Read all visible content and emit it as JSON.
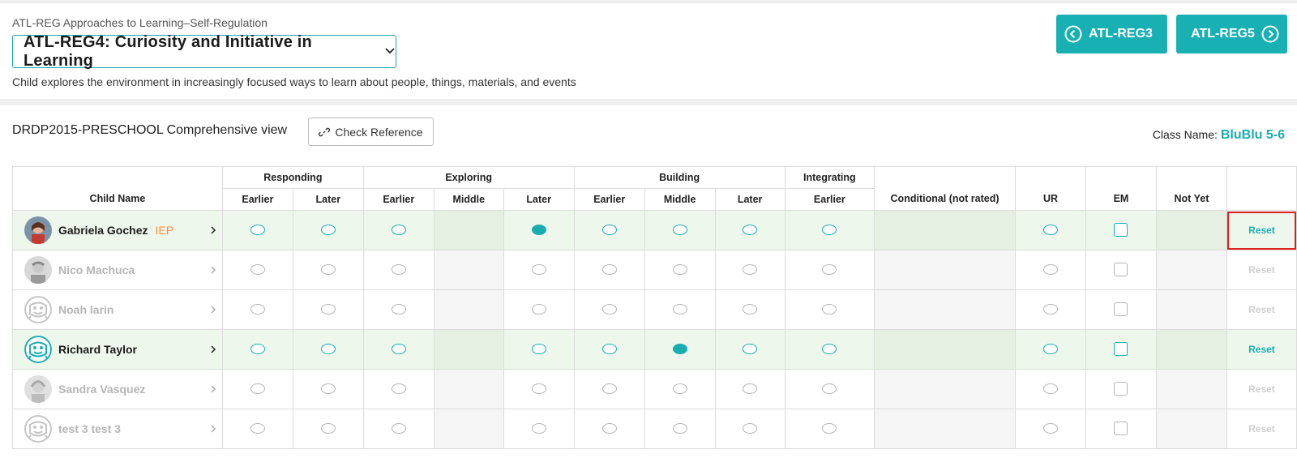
{
  "header": {
    "domain_label": "ATL-REG Approaches to Learning–Self-Regulation",
    "measure_title": "ATL-REG4: Curiosity and Initiative in Learning",
    "measure_description": "Child explores the environment in increasingly focused ways to learn about people, things, materials, and events",
    "prev_button": "ATL-REG3",
    "next_button": "ATL-REG5"
  },
  "main": {
    "view_title": "DRDP2015-PRESCHOOL Comprehensive view",
    "check_reference": "Check Reference",
    "class_name_label": "Class Name:",
    "class_name_value": "BluBlu 5-6"
  },
  "table": {
    "child_name_header": "Child Name",
    "groups": [
      "Responding",
      "Exploring",
      "Building",
      "Integrating"
    ],
    "levels": [
      "Earlier",
      "Later",
      "Earlier",
      "Middle",
      "Later",
      "Earlier",
      "Middle",
      "Later",
      "Earlier"
    ],
    "conditional": "Conditional (not rated)",
    "ur": "UR",
    "em": "EM",
    "not_yet": "Not Yet",
    "reset_label": "Reset",
    "rows": [
      {
        "name": "Gabriela Gochez",
        "iep": "IEP",
        "active": true,
        "selected_level": 4,
        "avatar": "photo-girl",
        "highlight_reset": true
      },
      {
        "name": "Nico Machuca",
        "iep": "",
        "active": false,
        "selected_level": -1,
        "avatar": "photo-boy",
        "highlight_reset": false
      },
      {
        "name": "Noah larin",
        "iep": "",
        "active": false,
        "selected_level": -1,
        "avatar": "robot",
        "highlight_reset": false
      },
      {
        "name": "Richard Taylor",
        "iep": "",
        "active": true,
        "selected_level": 6,
        "avatar": "robot",
        "highlight_reset": false
      },
      {
        "name": "Sandra Vasquez",
        "iep": "",
        "active": false,
        "selected_level": -1,
        "avatar": "photo-girl2",
        "highlight_reset": false
      },
      {
        "name": "test 3 test 3",
        "iep": "",
        "active": false,
        "selected_level": -1,
        "avatar": "robot",
        "highlight_reset": false
      }
    ]
  },
  "colors": {
    "accent": "#19b0b3",
    "iep": "#ff8c3b",
    "highlight": "#e0201d",
    "active_row": "#eef7ec"
  }
}
